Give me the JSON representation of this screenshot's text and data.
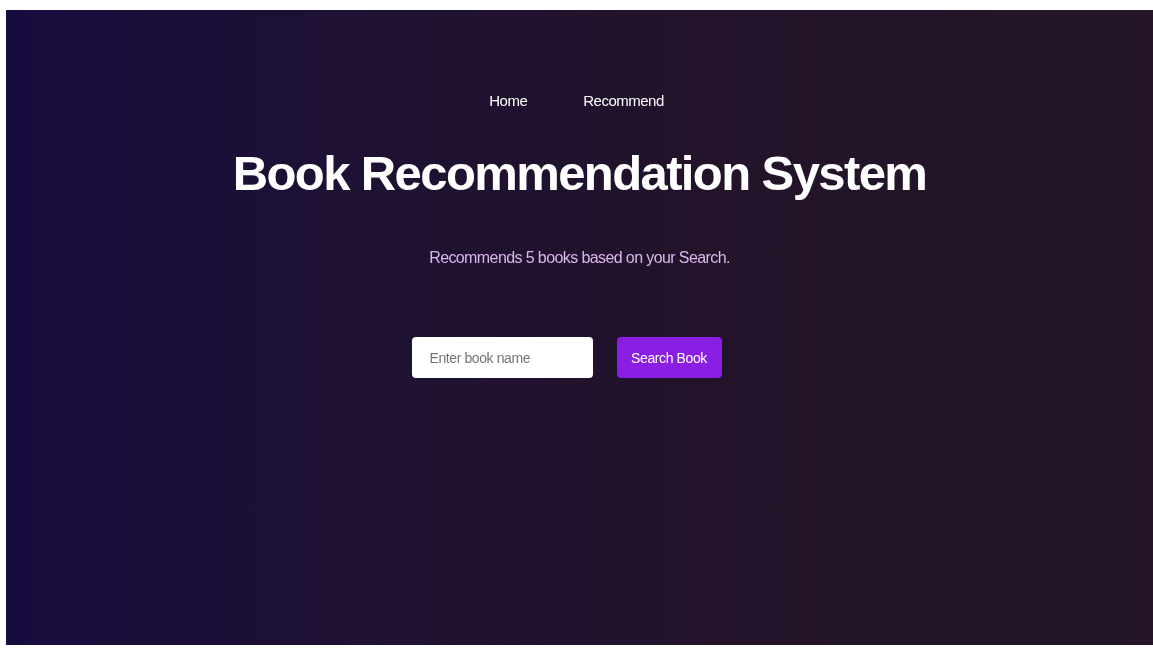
{
  "nav": [
    {
      "label": "Home"
    },
    {
      "label": "Recommend"
    }
  ],
  "title": "Book Recommendation System",
  "subtitle": "Recommends 5 books based on your Search.",
  "search": {
    "placeholder": "Enter book name",
    "button": "Search Book"
  }
}
